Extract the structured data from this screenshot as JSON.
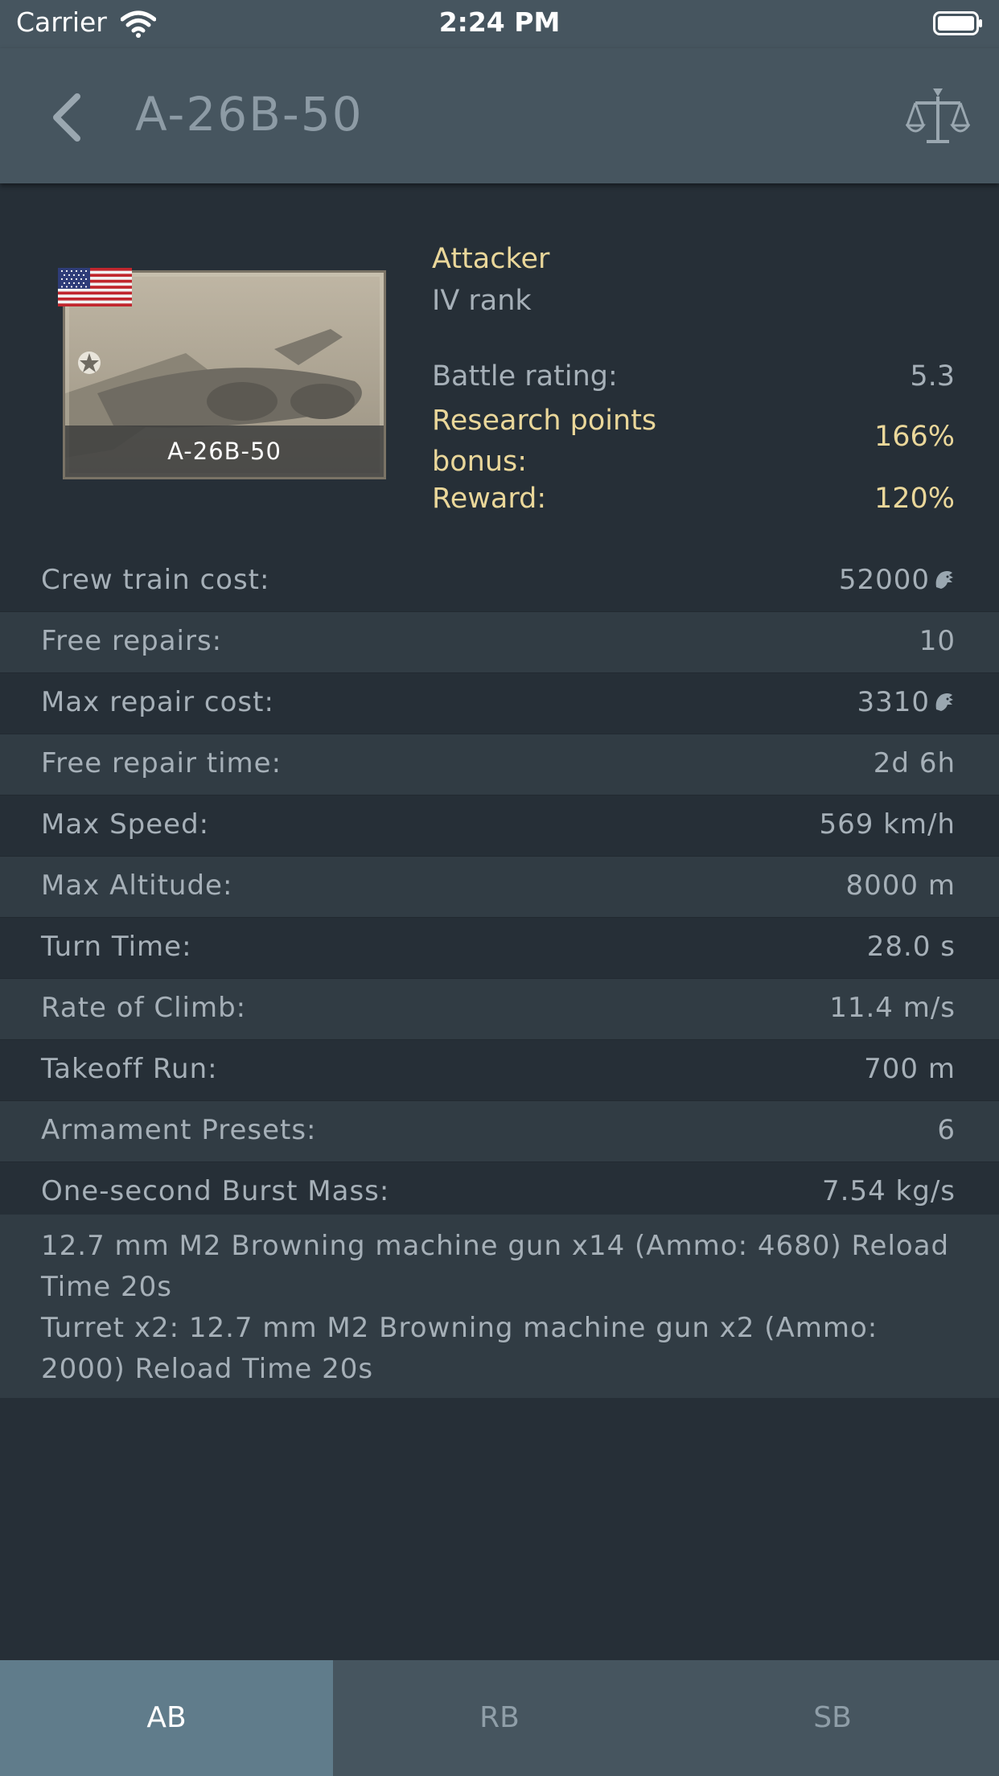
{
  "status_bar": {
    "carrier": "Carrier",
    "time": "2:24 PM"
  },
  "nav": {
    "title": "A-26B-50",
    "back_icon": "chevron-left-icon",
    "compare_icon": "balance-scale-icon"
  },
  "vehicle": {
    "card_caption": "A-26B-50",
    "flag_icon": "usa-flag-icon",
    "type": "Attacker",
    "rank": "IV rank",
    "battle_rating_label": "Battle rating:",
    "battle_rating_value": "5.3",
    "research_bonus_label": "Research points bonus:",
    "research_bonus_value": "166%",
    "reward_label": "Reward:",
    "reward_value": "120%"
  },
  "stats": [
    {
      "label": "Crew train cost:",
      "value": "52000",
      "silver_lion": true
    },
    {
      "label": "Free repairs:",
      "value": "10"
    },
    {
      "label": "Max repair cost:",
      "value": "3310",
      "silver_lion": true
    },
    {
      "label": "Free repair time:",
      "value": "2d 6h"
    },
    {
      "label": "Max Speed:",
      "value": "569 km/h"
    },
    {
      "label": "Max Altitude:",
      "value": "8000 m"
    },
    {
      "label": "Turn Time:",
      "value": "28.0 s"
    },
    {
      "label": "Rate of Climb:",
      "value": "11.4 m/s"
    },
    {
      "label": "Takeoff Run:",
      "value": "700 m"
    },
    {
      "label": "Armament Presets:",
      "value": "6"
    },
    {
      "label": "One-second Burst Mass:",
      "value": "7.54 kg/s"
    }
  ],
  "armament": [
    "12.7 mm M2 Browning machine gun x14 (Ammo: 4680) Reload Time 20s",
    "Turret x2: 12.7 mm M2 Browning machine gun x2 (Ammo: 2000) Reload Time 20s"
  ],
  "tabs": [
    {
      "label": "AB",
      "active": true
    },
    {
      "label": "RB",
      "active": false
    },
    {
      "label": "SB",
      "active": false
    }
  ],
  "colors": {
    "background": "#262f37",
    "row_alt": "#313c44",
    "header": "#46555f",
    "accent_yellow": "#ead79a",
    "tab_active": "#607c8b"
  }
}
